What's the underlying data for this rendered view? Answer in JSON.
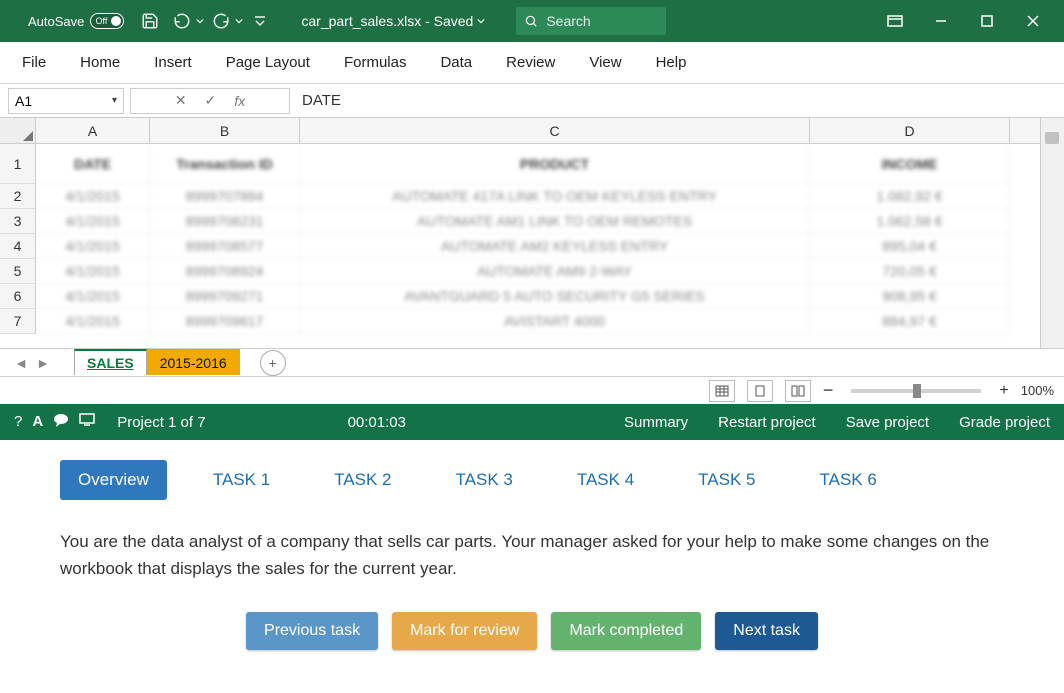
{
  "titlebar": {
    "autosave_label": "AutoSave",
    "autosave_state": "Off",
    "filename": "car_part_sales.xlsx - Saved",
    "search_placeholder": "Search"
  },
  "ribbon": {
    "tabs": [
      "File",
      "Home",
      "Insert",
      "Page Layout",
      "Formulas",
      "Data",
      "Review",
      "View",
      "Help"
    ]
  },
  "formula_bar": {
    "name_box": "A1",
    "fx_label": "fx",
    "value": "DATE"
  },
  "columns": [
    "A",
    "B",
    "C",
    "D"
  ],
  "grid": {
    "headers": {
      "a": "DATE",
      "b": "Transaction ID",
      "c": "PRODUCT",
      "d": "INCOME"
    },
    "rows": [
      {
        "n": "1"
      },
      {
        "n": "2",
        "a": "4/1/2015",
        "b": "8999707884",
        "c": "AUTOMATE 417A LINK TO OEM KEYLESS ENTRY",
        "d": "1.082,92 €"
      },
      {
        "n": "3",
        "a": "4/1/2015",
        "b": "8999708231",
        "c": "AUTOMATE AM1 LINK TO OEM REMOTES",
        "d": "1.062,58 €"
      },
      {
        "n": "4",
        "a": "4/1/2015",
        "b": "8999708577",
        "c": "AUTOMATE AM2 KEYLESS ENTRY",
        "d": "895,04 €"
      },
      {
        "n": "5",
        "a": "4/1/2015",
        "b": "8999708924",
        "c": "AUTOMATE AM9 2-WAY",
        "d": "720,05 €"
      },
      {
        "n": "6",
        "a": "4/1/2015",
        "b": "8999709271",
        "c": "AVANTGUARD 5 AUTO SECURITY G5 SERIES",
        "d": "908,95 €"
      },
      {
        "n": "7",
        "a": "4/1/2015",
        "b": "8999709617",
        "c": "AVISTART 4000",
        "d": "884,97 €"
      }
    ]
  },
  "sheet_tabs": {
    "active": "SALES",
    "second": "2015-2016"
  },
  "status": {
    "zoom": "100%",
    "minus": "−",
    "plus": "+"
  },
  "assessment": {
    "project_label": "Project 1 of 7",
    "timer": "00:01:03",
    "links": {
      "summary": "Summary",
      "restart": "Restart project",
      "save": "Save project",
      "grade": "Grade project"
    }
  },
  "tasks": {
    "tabs": [
      "Overview",
      "TASK 1",
      "TASK 2",
      "TASK 3",
      "TASK 4",
      "TASK 5",
      "TASK 6"
    ],
    "body": "You are the data analyst of a company that sells car parts. Your manager asked for your help to make some changes on the workbook that displays the sales for the current year.",
    "buttons": {
      "prev": "Previous task",
      "mark": "Mark for review",
      "comp": "Mark completed",
      "next": "Next task"
    }
  }
}
